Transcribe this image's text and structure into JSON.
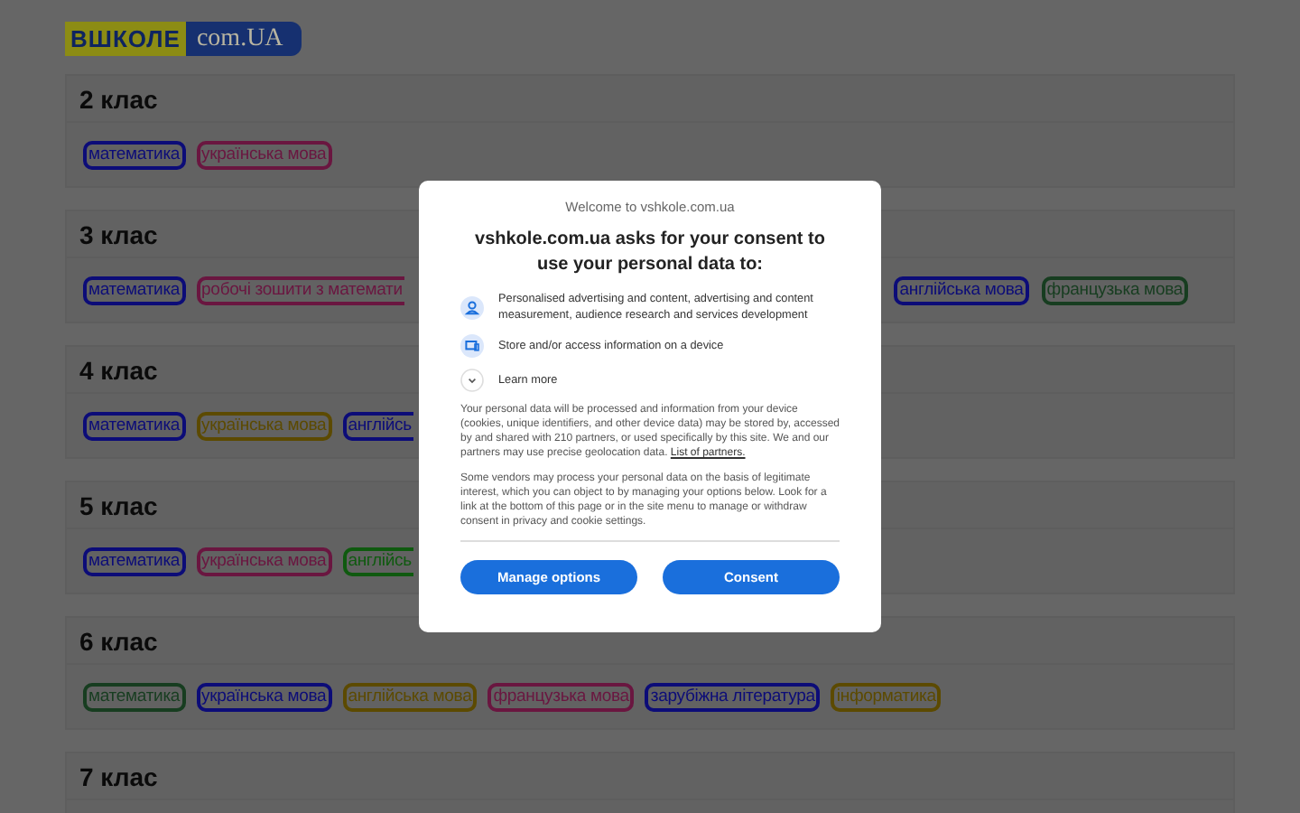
{
  "logo": {
    "left": "ВШКОЛЕ",
    "right": "com.UA"
  },
  "grades": [
    {
      "title": "2 клас",
      "tags": [
        {
          "label": "математика",
          "color": "#0c0c78"
        },
        {
          "label": "українська мова",
          "color": "#6a1640"
        }
      ]
    },
    {
      "title": "3 клас",
      "tags": [
        {
          "label": "математика",
          "color": "#0c0c78"
        },
        {
          "label": "робочі зошити з математи",
          "color": "#6a1640",
          "cut": true
        }
      ],
      "tags_after_dialog": [
        {
          "label": "англійська мова",
          "color": "#0c0c78"
        },
        {
          "label": "французька мова",
          "color": "#173d20"
        }
      ]
    },
    {
      "title": "4 клас",
      "tags": [
        {
          "label": "математика",
          "color": "#0c0c78"
        },
        {
          "label": "українська мова",
          "color": "#5c4a00"
        },
        {
          "label": "англійсь",
          "color": "#0c0c78",
          "cut": true
        }
      ]
    },
    {
      "title": "5 клас",
      "tags": [
        {
          "label": "математика",
          "color": "#0c0c78"
        },
        {
          "label": "українська мова",
          "color": "#6a1640"
        },
        {
          "label": "англійсь",
          "color": "#0f5a0f",
          "cut": true
        }
      ]
    },
    {
      "title": "6 клас",
      "tags": [
        {
          "label": "математика",
          "color": "#173d20"
        },
        {
          "label": "українська мова",
          "color": "#0c0c78"
        },
        {
          "label": "англійська мова",
          "color": "#5c4a00"
        },
        {
          "label": "французька мова",
          "color": "#6a1640"
        },
        {
          "label": "зарубіжна література",
          "color": "#0c0c78"
        },
        {
          "label": "інформатика",
          "color": "#5c4a00"
        }
      ]
    },
    {
      "title": "7 клас"
    }
  ],
  "consent": {
    "welcome": "Welcome to vshkole.com.ua",
    "title": "vshkole.com.ua asks for your consent to use your personal data to:",
    "purposes": [
      {
        "kind": "person",
        "text": "Personalised advertising and content, advertising and content measurement, audience research and services development"
      },
      {
        "kind": "device",
        "text": "Store and/or access information on a device"
      }
    ],
    "learn_more": "Learn more",
    "paragraph_1": "Your personal data will be processed and information from your device (cookies, unique identifiers, and other device data) may be stored by, accessed by and shared with 210 partners, or used specifically by this site. We and our partners may use precise geolocation data.",
    "partners_link": "List of partners.",
    "paragraph_2": "Some vendors may process your personal data on the basis of legitimate interest, which you can object to by managing your options below. Look for a link at the bottom of this page or in the site menu to manage or withdraw consent in privacy and cookie settings.",
    "buttons": [
      "Manage options",
      "Consent"
    ]
  }
}
